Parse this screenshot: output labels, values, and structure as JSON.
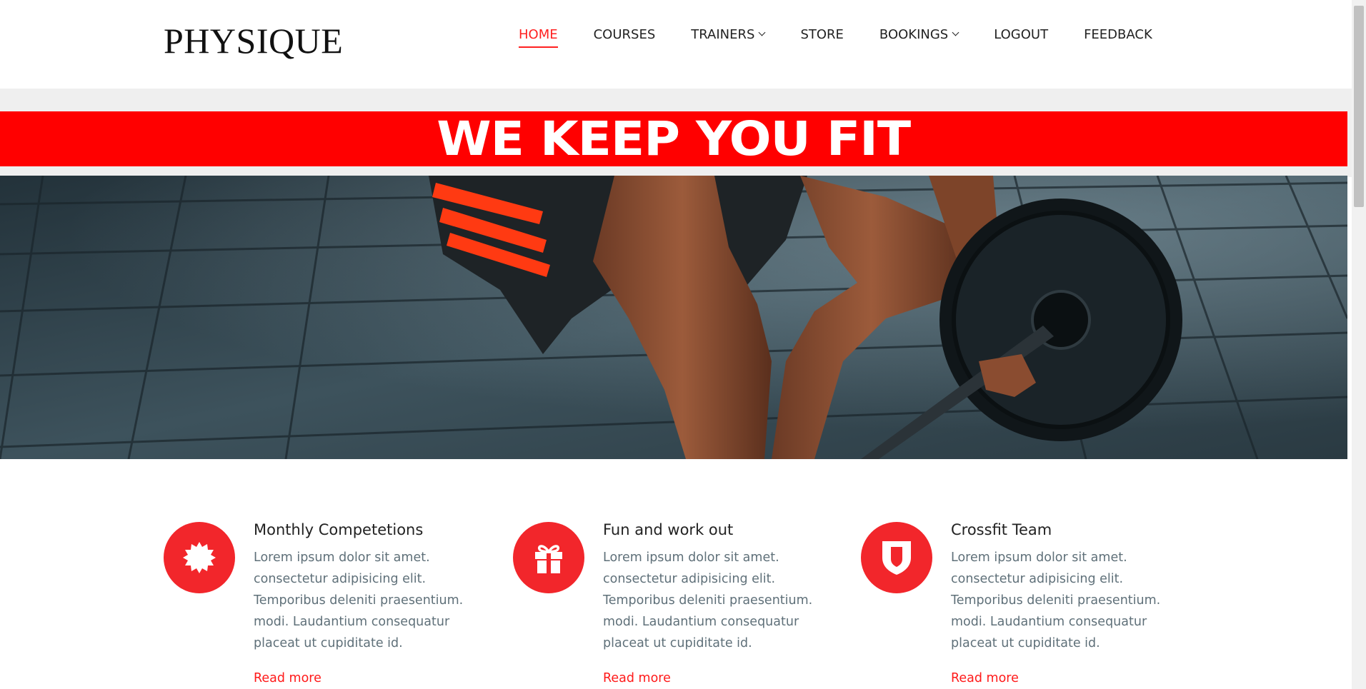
{
  "brand": {
    "logo": "PHYSIQUE",
    "accent_color": "#ff0000"
  },
  "nav": {
    "items": [
      {
        "label": "HOME",
        "active": true,
        "dropdown": false
      },
      {
        "label": "COURSES",
        "active": false,
        "dropdown": false
      },
      {
        "label": "TRAINERS",
        "active": false,
        "dropdown": true
      },
      {
        "label": "STORE",
        "active": false,
        "dropdown": false
      },
      {
        "label": "BOOKINGS",
        "active": false,
        "dropdown": true
      },
      {
        "label": "LOGOUT",
        "active": false,
        "dropdown": false
      },
      {
        "label": "FEEDBACK",
        "active": false,
        "dropdown": false
      }
    ]
  },
  "banner": {
    "text": "WE KEEP YOU FIT"
  },
  "hero": {
    "image": "athlete-lifting-barbell-photo"
  },
  "features": [
    {
      "icon": "badge-icon",
      "title": "Monthly Competetions",
      "text": "Lorem ipsum dolor sit amet. consectetur adipisicing elit. Temporibus deleniti praesentium. modi. Laudantium consequatur placeat ut cupiditate id.",
      "link": "Read more"
    },
    {
      "icon": "gift-icon",
      "title": "Fun and work out",
      "text": "Lorem ipsum dolor sit amet. consectetur adipisicing elit. Temporibus deleniti praesentium. modi. Laudantium consequatur placeat ut cupiditate id.",
      "link": "Read more"
    },
    {
      "icon": "shield-icon",
      "title": "Crossfit Team",
      "text": "Lorem ipsum dolor sit amet. consectetur adipisicing elit. Temporibus deleniti praesentium. modi. Laudantium consequatur placeat ut cupiditate id.",
      "link": "Read more"
    }
  ]
}
